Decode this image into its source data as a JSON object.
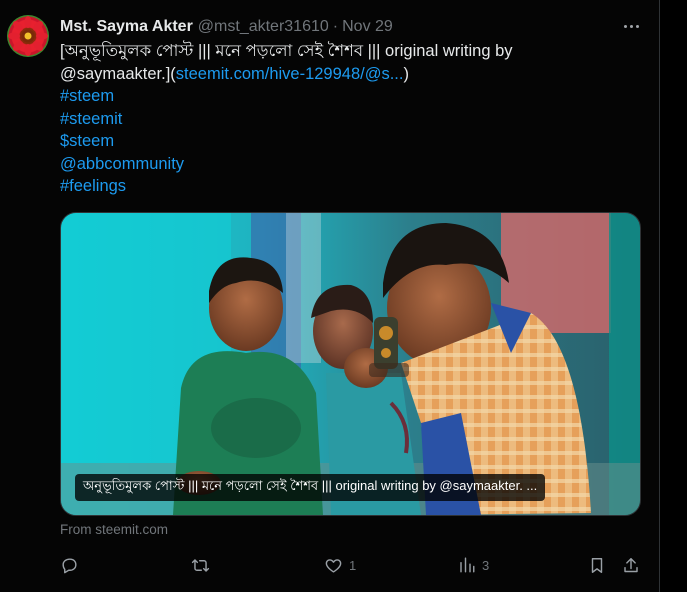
{
  "tweet": {
    "author_name": "Mst. Sayma Akter",
    "handle": "@mst_akter31610",
    "separator": "·",
    "date": "Nov 29",
    "text_line1": "[অনুভূতিমুলক পোস্ট ||| মনে পড়লো সেই শৈশব ||| original writing by",
    "text_line2_plain": "@saymaakter.](",
    "text_line2_link": "steemit.com/hive-129948/@s...",
    "text_line2_end": ")",
    "tags": [
      "#steem",
      "#steemit",
      "$steem",
      "@abbcommunity",
      "#feelings"
    ],
    "media_caption": "অনুভূতিমুলক পোস্ট ||| মনে পড়লো সেই শৈশব ||| original writing by @saymaakter. ...",
    "source": "From steemit.com",
    "likes": "1",
    "views": "3"
  },
  "icons": {
    "more": "more-horizontal-icon",
    "reply": "reply-icon",
    "retweet": "retweet-icon",
    "like": "heart-icon",
    "views": "views-chart-icon",
    "bookmark": "bookmark-icon",
    "share": "share-icon"
  },
  "colors": {
    "background": "#000000",
    "text": "#e7e9ea",
    "muted": "#71767b",
    "link": "#1d9bf0"
  }
}
